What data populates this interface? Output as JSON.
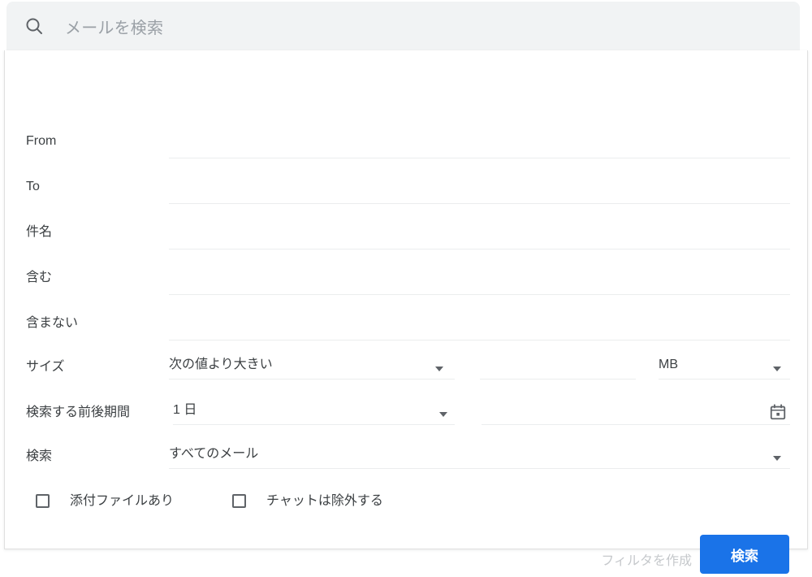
{
  "search_bar": {
    "icon": "search-icon",
    "placeholder": "メールを検索",
    "value": ""
  },
  "form": {
    "rows": [
      {
        "label": "From",
        "value": "",
        "placeholder": ""
      },
      {
        "label": "To",
        "value": "",
        "placeholder": ""
      },
      {
        "label": "件名",
        "value": "",
        "placeholder": ""
      },
      {
        "label": "含む",
        "value": "",
        "placeholder": ""
      },
      {
        "label": "含まない",
        "value": "",
        "placeholder": ""
      }
    ],
    "size": {
      "label": "サイズ",
      "operator": "次の値より大きい",
      "amount": "",
      "unit": "MB"
    },
    "date": {
      "label": "検索する前後期間",
      "range": "1 日",
      "date_value": "",
      "calendar_icon": "calendar-icon"
    },
    "scope": {
      "label": "検索",
      "value": "すべてのメール"
    },
    "checkboxes": [
      {
        "label": "添付ファイルあり",
        "checked": false
      },
      {
        "label": "チャットは除外する",
        "checked": false
      }
    ]
  },
  "actions": {
    "create_filter_label": "フィルタを作成",
    "search_label": "検索"
  },
  "colors": {
    "accent": "#1a73e8",
    "header_bg": "#f1f3f4",
    "text": "#3c4043",
    "muted": "#9aa0a6",
    "disabled": "#c6c9cc",
    "underline": "#ebedee"
  }
}
